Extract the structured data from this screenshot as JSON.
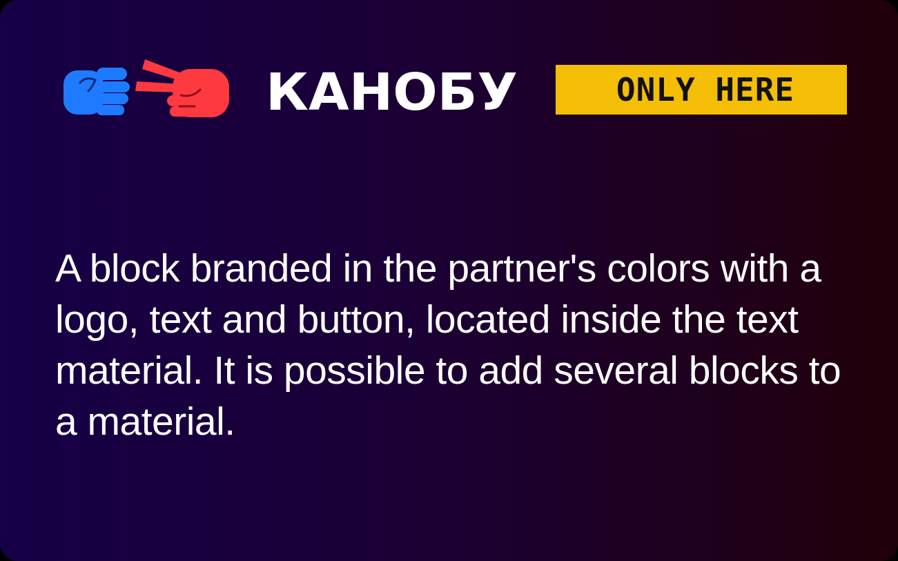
{
  "logo": {
    "brand_text": "КАНОБУ",
    "icon": "rock-paper-scissors-hands-icon",
    "colors": {
      "fist": "#1e7bff",
      "scissors_hand": "#ff3940"
    }
  },
  "badge": {
    "label": "ONLY HERE",
    "color": "#f3be05"
  },
  "description": "A block branded in the partner's colors with a logo, text and button, located inside the text material. It is possible to add several blocks to a material."
}
